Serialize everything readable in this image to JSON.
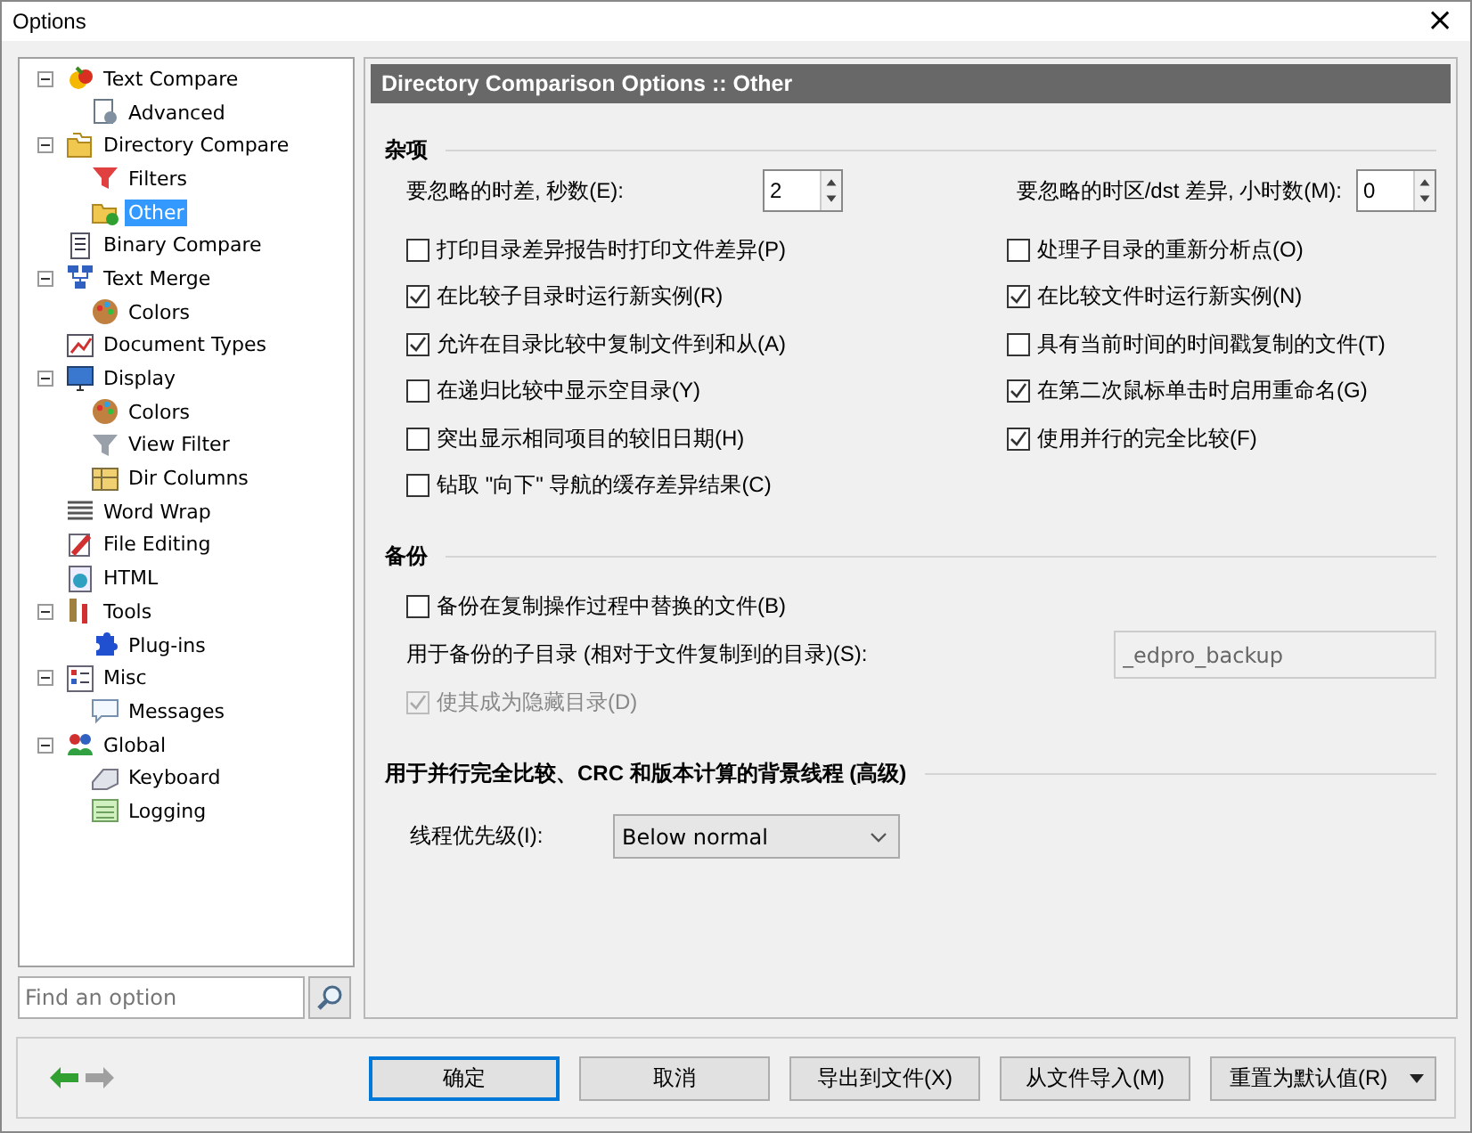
{
  "window": {
    "title": "Options",
    "close": "×"
  },
  "tree": [
    {
      "label": "Text Compare",
      "selected": false,
      "expanded": true,
      "children": [
        {
          "label": "Advanced",
          "selected": false
        }
      ]
    },
    {
      "label": "Directory Compare",
      "selected": false,
      "expanded": true,
      "children": [
        {
          "label": "Filters",
          "selected": false
        },
        {
          "label": "Other",
          "selected": true
        }
      ]
    },
    {
      "label": "Binary Compare",
      "selected": false
    },
    {
      "label": "Text Merge",
      "selected": false,
      "expanded": true,
      "children": [
        {
          "label": "Colors",
          "selected": false
        }
      ]
    },
    {
      "label": "Document Types",
      "selected": false
    },
    {
      "label": "Display",
      "selected": false,
      "expanded": true,
      "children": [
        {
          "label": "Colors",
          "selected": false
        },
        {
          "label": "View Filter",
          "selected": false
        },
        {
          "label": "Dir Columns",
          "selected": false
        }
      ]
    },
    {
      "label": "Word Wrap",
      "selected": false
    },
    {
      "label": "File Editing",
      "selected": false
    },
    {
      "label": "HTML",
      "selected": false
    },
    {
      "label": "Tools",
      "selected": false,
      "expanded": true,
      "children": [
        {
          "label": "Plug-ins",
          "selected": false
        }
      ]
    },
    {
      "label": "Misc",
      "selected": false,
      "expanded": true,
      "children": [
        {
          "label": "Messages",
          "selected": false
        }
      ]
    },
    {
      "label": "Global",
      "selected": false,
      "expanded": true,
      "children": [
        {
          "label": "Keyboard",
          "selected": false
        },
        {
          "label": "Logging",
          "selected": false
        }
      ]
    }
  ],
  "search": {
    "placeholder": "Find an option"
  },
  "panel_title": "Directory Comparison Options :: Other",
  "misc": {
    "heading": "杂项",
    "spin_left": {
      "label": "要忽略的时差, 秒数(E):",
      "value": "2"
    },
    "spin_right": {
      "label": "要忽略的时区/dst 差异, 小时数(M):",
      "value": "0"
    },
    "options_left": [
      {
        "label": "打印目录差异报告时打印文件差异(P)",
        "checked": false
      },
      {
        "label": "在比较子目录时运行新实例(R)",
        "checked": true
      },
      {
        "label": "允许在目录比较中复制文件到和从(A)",
        "checked": true
      },
      {
        "label": "在递归比较中显示空目录(Y)",
        "checked": false
      },
      {
        "label": "突出显示相同项目的较旧日期(H)",
        "checked": false
      },
      {
        "label": "钻取 \"向下\" 导航的缓存差异结果(C)",
        "checked": false
      }
    ],
    "options_right": [
      {
        "label": "处理子目录的重新分析点(O)",
        "checked": false
      },
      {
        "label": "在比较文件时运行新实例(N)",
        "checked": true
      },
      {
        "label": "具有当前时间的时间戳复制的文件(T)",
        "checked": false
      },
      {
        "label": "在第二次鼠标单击时启用重命名(G)",
        "checked": true
      },
      {
        "label": "使用并行的完全比较(F)",
        "checked": true
      }
    ]
  },
  "backup": {
    "heading": "备份",
    "option": {
      "label": "备份在复制操作过程中替换的文件(B)",
      "checked": false
    },
    "subdir": {
      "label": "用于备份的子目录 (相对于文件复制到的目录)(S):",
      "value": "_edpro_backup",
      "disabled": true
    },
    "hidden": {
      "label": "使其成为隐藏目录(D)",
      "checked": true,
      "disabled": true
    }
  },
  "threads": {
    "heading": "用于并行完全比较、CRC 和版本计算的背景线程 (高级)",
    "priority": {
      "label": "线程优先级(I):",
      "value": "Below normal"
    }
  },
  "buttons": [
    {
      "label": "确定",
      "default": true
    },
    {
      "label": "取消",
      "default": false
    },
    {
      "label": "导出到文件(X)",
      "default": false
    },
    {
      "label": "从文件导入(M)",
      "default": false
    },
    {
      "label": "重置为默认值(R)",
      "default": false,
      "menu": true
    }
  ]
}
